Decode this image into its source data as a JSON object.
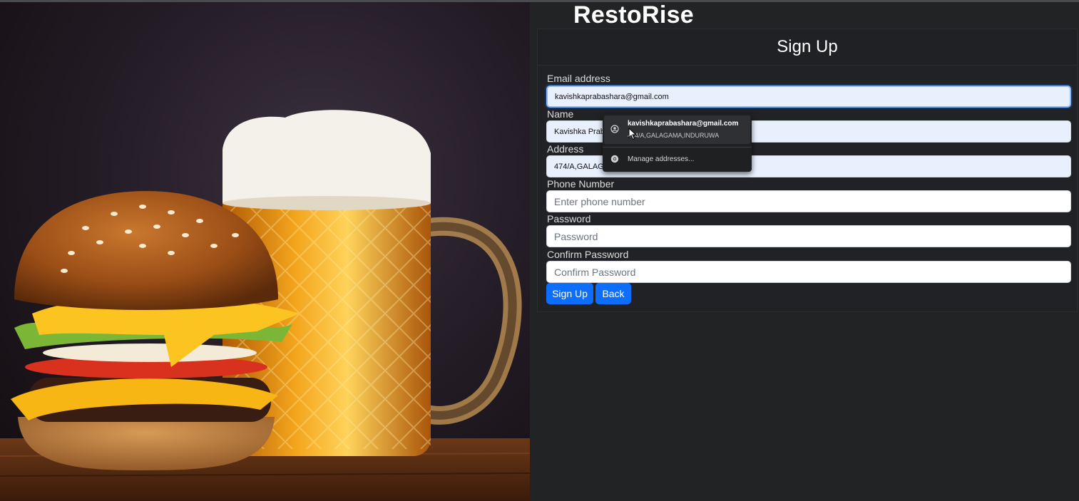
{
  "brand": {
    "title": "RestoRise"
  },
  "form": {
    "title": "Sign Up",
    "email_label": "Email address",
    "email_value": "kavishkaprabashara@gmail.com",
    "name_label": "Name",
    "name_value": "Kavishka Prab",
    "address_label": "Address",
    "address_value": "474/A,GALAG",
    "phone_label": "Phone Number",
    "phone_placeholder": "Enter phone number",
    "password_label": "Password",
    "password_placeholder": "Password",
    "confirm_label": "Confirm Password",
    "confirm_placeholder": "Confirm Password",
    "signup_button": "Sign Up",
    "back_button": "Back"
  },
  "autofill": {
    "email": "kavishkaprabashara@gmail.com",
    "address": "474/A,GALAGAMA,INDURUWA",
    "manage": "Manage addresses..."
  },
  "colors": {
    "primary": "#0d6efd",
    "background": "#222325",
    "autofill_bg": "#e8f0fe"
  },
  "icons": {
    "profile": "account-circle-icon",
    "manage": "chrome-icon",
    "cursor": "mouse-pointer-icon"
  }
}
